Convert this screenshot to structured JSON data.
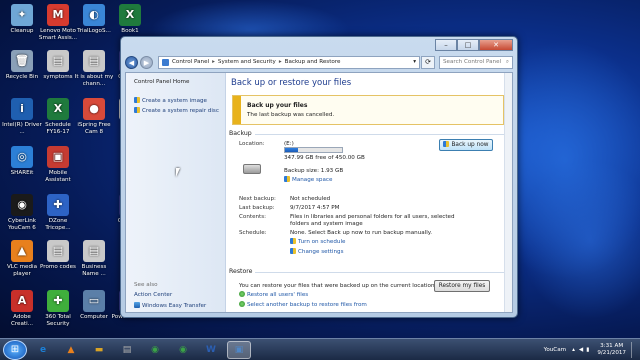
{
  "desktop": {
    "icons": [
      {
        "label": "Cleanup",
        "glyph": "✦",
        "color": "#6fa7d6"
      },
      {
        "label": "Lenovo Moto Smart Assis...",
        "glyph": "M",
        "color": "#d63b2f"
      },
      {
        "label": "TrialLogoS...",
        "glyph": "◐",
        "color": "#3a86d6"
      },
      {
        "label": "Book1",
        "glyph": "X",
        "color": "#1f7a3d"
      },
      {
        "label": "Recycle Bin",
        "glyph": "🗑",
        "color": "#8aa0b8"
      },
      {
        "label": "symptoms",
        "glyph": "▤",
        "color": "#c9c9c9"
      },
      {
        "label": "It is about my chann...",
        "glyph": "▤",
        "color": "#c9c9c9"
      },
      {
        "label": "Cyb Pow",
        "glyph": "C",
        "color": "#333a8c"
      },
      {
        "label": "Intel(R) Driver ...",
        "glyph": "i",
        "color": "#1f5fb0"
      },
      {
        "label": "Schedule FY16-17",
        "glyph": "X",
        "color": "#1f7a3d"
      },
      {
        "label": "iSpring Free Cam 8",
        "glyph": "●",
        "color": "#d84a3a"
      },
      {
        "label": "Hai",
        "glyph": "▤",
        "color": "#c9c9c9"
      },
      {
        "label": "SHAREit",
        "glyph": "◎",
        "color": "#2c7fd6"
      },
      {
        "label": "Mobile Assistant",
        "glyph": "▣",
        "color": "#c53b32"
      },
      {
        "label": "CyberLink YouCam 6",
        "glyph": "◉",
        "color": "#1a1a1a"
      },
      {
        "label": "DZone Tricope...",
        "glyph": "✚",
        "color": "#2d63c5"
      },
      {
        "label": "Cyb vide",
        "glyph": "C",
        "color": "#333a8c"
      },
      {
        "label": "VLC media player",
        "glyph": "▲",
        "color": "#e8801d"
      },
      {
        "label": "Promo codes",
        "glyph": "▤",
        "color": "#c9c9c9"
      },
      {
        "label": "Business Name ...",
        "glyph": "▤",
        "color": "#c9c9c9"
      },
      {
        "label": "Adobe Creati...",
        "glyph": "A",
        "color": "#c8302a"
      },
      {
        "label": "360 Total Security",
        "glyph": "✚",
        "color": "#3fae3c"
      },
      {
        "label": "Computer",
        "glyph": "▭",
        "color": "#5b7fa8"
      },
      {
        "label": "PowerDirec...",
        "glyph": "P",
        "color": "#333a8c"
      }
    ]
  },
  "window": {
    "caption": {
      "minimize": "–",
      "maximize": "□",
      "close": "✕"
    },
    "nav": {
      "back": "◀",
      "forward": "▶",
      "dropdown": "▾",
      "refresh": "⟳"
    },
    "breadcrumb": [
      "Control Panel",
      "System and Security",
      "Backup and Restore"
    ],
    "search_placeholder": "Search Control Panel",
    "left": {
      "home": "Control Panel Home",
      "create_image": "Create a system image",
      "repair_disc": "Create a system repair disc",
      "see_also": "See also",
      "action_center": "Action Center",
      "easy_transfer": "Windows Easy Transfer"
    },
    "title": "Back up or restore your files",
    "banner": {
      "title": "Back up your files",
      "text": "The last backup was cancelled."
    },
    "backup": {
      "heading": "Backup",
      "location_label": "Location:",
      "location_value": "(E:)",
      "free_text": "347.99 GB free of 450.00 GB",
      "used_fraction": 0.227,
      "size_text": "Backup size: 1.93 GB",
      "manage_space": "Manage space",
      "backup_now": "Back up now",
      "next_label": "Next backup:",
      "next_value": "Not scheduled",
      "last_label": "Last backup:",
      "last_value": "9/7/2017 4:57 PM",
      "contents_label": "Contents:",
      "contents_value_1": "Files in libraries and personal folders for all users, selected",
      "contents_value_2": "folders and system image",
      "schedule_label": "Schedule:",
      "schedule_value": "None. Select Back up now to run backup manually.",
      "turn_on": "Turn on schedule",
      "change_settings": "Change settings"
    },
    "restore": {
      "heading": "Restore",
      "text": "You can restore your files that were backed up on the current location.",
      "restore_all": "Restore all users' files",
      "select_another": "Select another backup to restore files from",
      "restore_my": "Restore my files"
    }
  },
  "taskbar": {
    "start": "⊞",
    "items": [
      {
        "glyph": "e",
        "color": "#1c7fd6"
      },
      {
        "glyph": "▲",
        "color": "#e8801d"
      },
      {
        "glyph": "▬",
        "color": "#d8a326"
      },
      {
        "glyph": "▤",
        "color": "#b0b0b0"
      },
      {
        "glyph": "◉",
        "color": "#3aa346"
      },
      {
        "glyph": "◉",
        "color": "#3aa346"
      },
      {
        "glyph": "W",
        "color": "#2b5fb3"
      },
      {
        "glyph": "▣",
        "color": "#4f86c6"
      }
    ],
    "tray_app": "YouCam",
    "time": "3:31 AM",
    "date": "9/21/2017"
  }
}
